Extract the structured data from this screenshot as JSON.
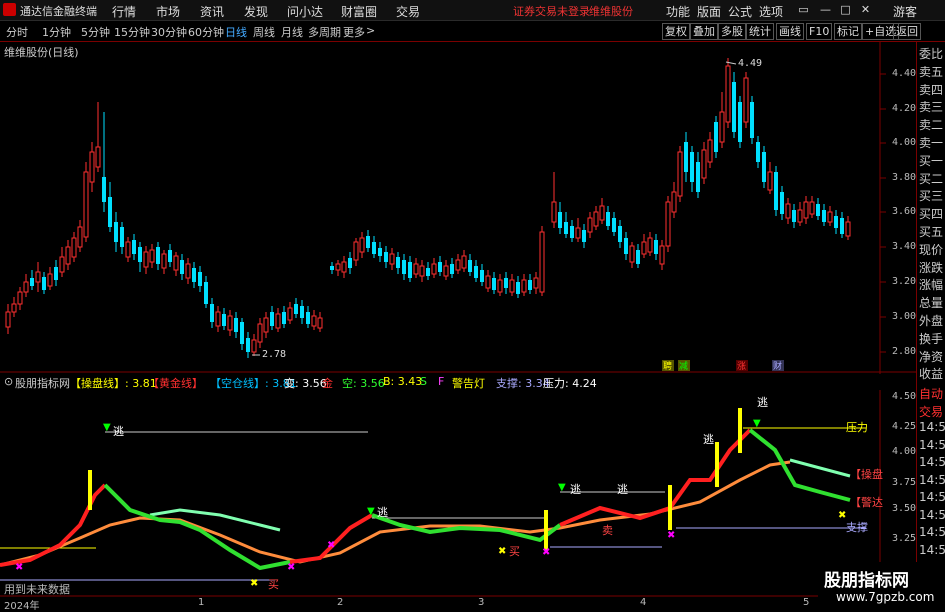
{
  "titlebar": {
    "app_name": "通达信金融终端",
    "menus": [
      "行情",
      "市场",
      "资讯",
      "发现",
      "问小达",
      "财富圈",
      "交易"
    ],
    "notice": "证券交易未登录",
    "stock": "维维股份",
    "right_menus": [
      "功能",
      "版面",
      "公式",
      "选项"
    ],
    "guest": "游客"
  },
  "periodbar": {
    "periods": [
      "分时",
      "1分钟",
      "5分钟",
      "15分钟",
      "30分钟",
      "60分钟",
      "日线",
      "周线",
      "月线",
      "多周期",
      "更多"
    ],
    "active": "日线",
    "tools": [
      "复权",
      "叠加",
      "多股",
      "统计",
      "画线",
      "F10",
      "标记",
      "+自选",
      "返回"
    ]
  },
  "main_chart": {
    "title": "维维股份(日线)",
    "price_labels": [
      "4.40",
      "4.20",
      "4.00",
      "3.80",
      "3.60",
      "3.40",
      "3.20",
      "3.00",
      "2.80"
    ],
    "high_label": "4.49",
    "low_label": "2.78",
    "event_tags": [
      "聘",
      "减",
      "涨",
      "财"
    ]
  },
  "right_panel": {
    "items": [
      "委比",
      "卖五",
      "卖四",
      "卖三",
      "卖二",
      "卖一",
      "买一",
      "买二",
      "买三",
      "买四",
      "买五",
      "现价",
      "涨跌",
      "涨幅",
      "总量",
      "外盘",
      "换手",
      "净资",
      "收益"
    ]
  },
  "right_panel_lower": {
    "items": [
      "自动",
      "交易",
      "14:5",
      "14:5",
      "14:5",
      "14:5",
      "14:5",
      "14:5",
      "14:5",
      "14:5",
      "14:5",
      "14:5"
    ]
  },
  "indicator_bar": {
    "name": "股朋指标网",
    "items": [
      {
        "text": "【操盘线】: 3.81",
        "color": "#ffff00"
      },
      {
        "text": "【黄金线】",
        "color": "#ff3030"
      },
      {
        "text": "【空仓线】: 3.81",
        "color": "#00c0ff"
      },
      {
        "text": "变: 3.56",
        "color": "#ffffff"
      },
      {
        "text": "金",
        "color": "#ff3030"
      },
      {
        "text": "空: 3.56",
        "color": "#30ff30"
      },
      {
        "text": "B: 3.43",
        "color": "#ffff00"
      },
      {
        "text": "S",
        "color": "#30ff30"
      },
      {
        "text": "F",
        "color": "#ff40ff"
      },
      {
        "text": "警告灯",
        "color": "#ffff00"
      },
      {
        "text": "支撑: 3.34",
        "color": "#aaaaff"
      },
      {
        "text": "压力: 4.24",
        "color": "#ffffff"
      }
    ]
  },
  "indicator_chart": {
    "y_labels": [
      "4.50",
      "4.25",
      "4.00",
      "3.75",
      "3.50",
      "3.25"
    ],
    "pressure_label": "压力",
    "support_label": "支撑",
    "escape_label": "逃",
    "buy_label": "买",
    "sell_label": "卖",
    "right_tags": [
      "【操盘",
      "【警达"
    ],
    "footnote": "用到未来数据"
  },
  "datebar": {
    "labels": [
      "2024年",
      "1",
      "2",
      "3",
      "4",
      "5"
    ]
  },
  "watermark": {
    "line1": "股朋指标网",
    "line2": "www.7gpzb.com"
  },
  "colors": {
    "up": "#ff3030",
    "down": "#00e0ff",
    "grid_red": "#7a0000"
  }
}
